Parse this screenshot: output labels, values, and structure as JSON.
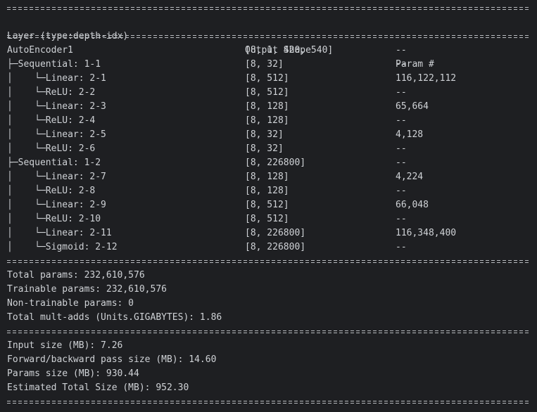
{
  "header": {
    "layer": "Layer (type:depth-idx)",
    "output_shape": "Output Shape",
    "param": "Param #"
  },
  "rows": [
    {
      "layer": "AutoEncoder1",
      "shape": "[8, 1, 420, 540]",
      "param": "--"
    },
    {
      "layer": "├─Sequential: 1-1",
      "shape": "[8, 32]",
      "param": "--"
    },
    {
      "layer": "│    └─Linear: 2-1",
      "shape": "[8, 512]",
      "param": "116,122,112"
    },
    {
      "layer": "│    └─ReLU: 2-2",
      "shape": "[8, 512]",
      "param": "--"
    },
    {
      "layer": "│    └─Linear: 2-3",
      "shape": "[8, 128]",
      "param": "65,664"
    },
    {
      "layer": "│    └─ReLU: 2-4",
      "shape": "[8, 128]",
      "param": "--"
    },
    {
      "layer": "│    └─Linear: 2-5",
      "shape": "[8, 32]",
      "param": "4,128"
    },
    {
      "layer": "│    └─ReLU: 2-6",
      "shape": "[8, 32]",
      "param": "--"
    },
    {
      "layer": "├─Sequential: 1-2",
      "shape": "[8, 226800]",
      "param": "--"
    },
    {
      "layer": "│    └─Linear: 2-7",
      "shape": "[8, 128]",
      "param": "4,224"
    },
    {
      "layer": "│    └─ReLU: 2-8",
      "shape": "[8, 128]",
      "param": "--"
    },
    {
      "layer": "│    └─Linear: 2-9",
      "shape": "[8, 512]",
      "param": "66,048"
    },
    {
      "layer": "│    └─ReLU: 2-10",
      "shape": "[8, 512]",
      "param": "--"
    },
    {
      "layer": "│    └─Linear: 2-11",
      "shape": "[8, 226800]",
      "param": "116,348,400"
    },
    {
      "layer": "│    └─Sigmoid: 2-12",
      "shape": "[8, 226800]",
      "param": "--"
    }
  ],
  "params_summary": [
    "Total params: 232,610,576",
    "Trainable params: 232,610,576",
    "Non-trainable params: 0",
    "Total mult-adds (Units.GIGABYTES): 1.86"
  ],
  "size_summary": [
    "Input size (MB): 7.26",
    "Forward/backward pass size (MB): 14.60",
    "Params size (MB): 930.44",
    "Estimated Total Size (MB): 952.30"
  ]
}
